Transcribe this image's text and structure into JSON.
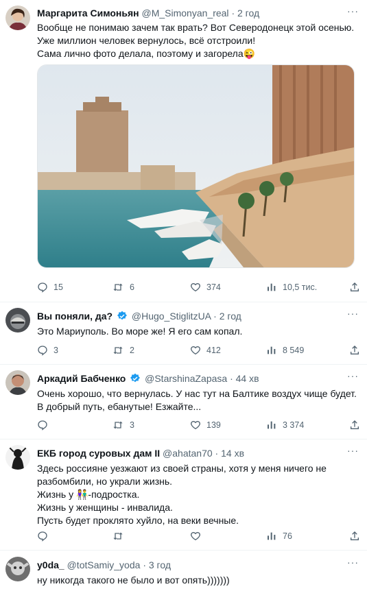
{
  "tweets": [
    {
      "name": "Маргарита Симоньян",
      "handle": "@M_Simonyan_real",
      "time": "2 год",
      "lines": [
        "Вообще не понимаю зачем так врать? Вот Северодонецк этой осенью.",
        "Уже миллион человек вернулось, всё отстроили!",
        "Сама лично фото делала, поэтому и загорела"
      ],
      "emoji": "😜",
      "replies": "15",
      "retweets": "6",
      "likes": "374",
      "views": "10,5 тис."
    },
    {
      "name": "Вы поняли, да?",
      "handle": "@Hugo_StiglitzUA",
      "time": "2 год",
      "lines": [
        "Это Мариуполь. Во море же! Я его сам копал."
      ],
      "replies": "3",
      "retweets": "2",
      "likes": "412",
      "views": "8 549"
    },
    {
      "name": "Аркадий Бабченко",
      "handle": "@StarshinaZapasa",
      "time": "44 хв",
      "lines": [
        "Очень хорошо, что вернулась. У нас тут на Балтике воздух чище будет.",
        "В добрый путь, ебанутые! Езжайте..."
      ],
      "replies": "",
      "retweets": "3",
      "likes": "139",
      "views": "3 374"
    },
    {
      "name": "ЕКБ город суровых дам II",
      "handle": "@ahatan70",
      "time": "14 хв",
      "lines": [
        "Здесь россияне уезжают из своей страны, хотя у меня ничего не",
        "разбомбили,  но украли жизнь.",
        "Жизнь у",
        "Жизнь у женщины - инвалида.",
        "Пусть будет проклято хуйло, на веки вечные."
      ],
      "line3_suffix": "-подростка.",
      "emoji": "👫",
      "replies": "",
      "retweets": "",
      "likes": "",
      "views": "76"
    },
    {
      "name": "y0da_",
      "handle": "@totSamiy_yoda",
      "time": "3 год",
      "lines": [
        "ну никогда такого не было и вот опять)))))))"
      ]
    }
  ],
  "ui": {
    "dot": "·",
    "more": "···"
  },
  "colors": {
    "verified": "#1d9bf0",
    "muted": "#536471",
    "divider": "#eff3f4"
  }
}
